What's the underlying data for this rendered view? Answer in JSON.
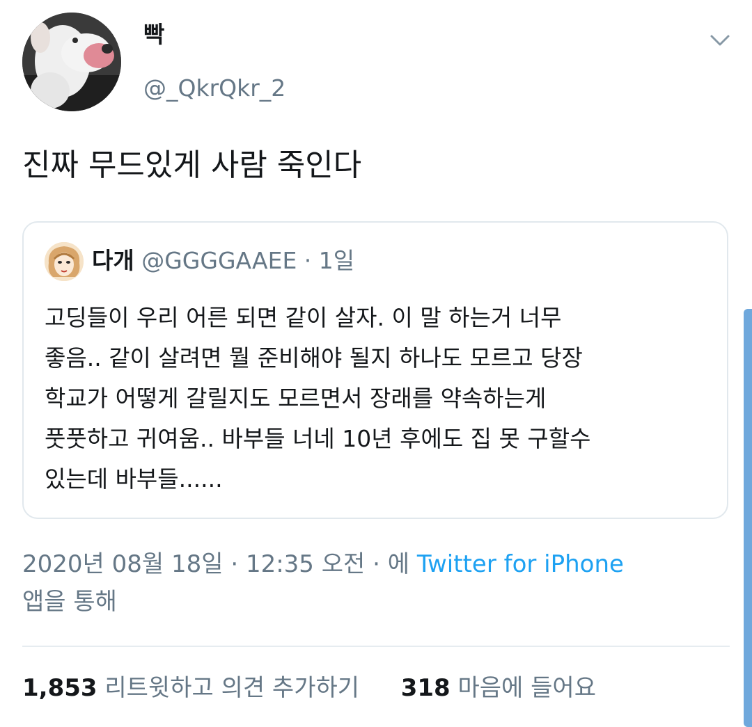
{
  "tweet": {
    "display_name": "빡",
    "handle": "@_QkrQkr_2",
    "text": "진짜 무드있게 사람 죽인다",
    "avatar_icon": "dog-avatar-icon",
    "menu_icon": "chevron-down-icon"
  },
  "quote": {
    "display_name": "다개",
    "handle": "@GGGGAAEE",
    "separator": "·",
    "time": "1일",
    "avatar_icon": "illustrated-face-avatar-icon",
    "body_lines": [
      "고딩들이 우리 어른 되면 같이 살자. 이 말 하는거 너무",
      "좋음.. 같이 살려면 뭘 준비해야 될지 하나도 모르고 당장",
      "학교가 어떻게 갈릴지도 모르면서 장래를 약속하는게",
      "풋풋하고 귀여움.. 바부들 너네 10년 후에도 집 못 구할수",
      "있는데 바부들......"
    ]
  },
  "meta": {
    "date": "2020년 08월 18일",
    "separator": "·",
    "time": "12:35 오전",
    "via_prefix": "에",
    "source": "Twitter for iPhone",
    "via_suffix": "앱을 통해"
  },
  "stats": {
    "retweets_count": "1,853",
    "retweets_label": "리트윗하고 의견 추가하기",
    "likes_count": "318",
    "likes_label": "마음에 들어요"
  },
  "colors": {
    "primary_text": "#14171a",
    "secondary_text": "#657786",
    "link": "#1da1f2",
    "border": "#e1e8ed",
    "scrollbar": "#6fa8dc"
  }
}
